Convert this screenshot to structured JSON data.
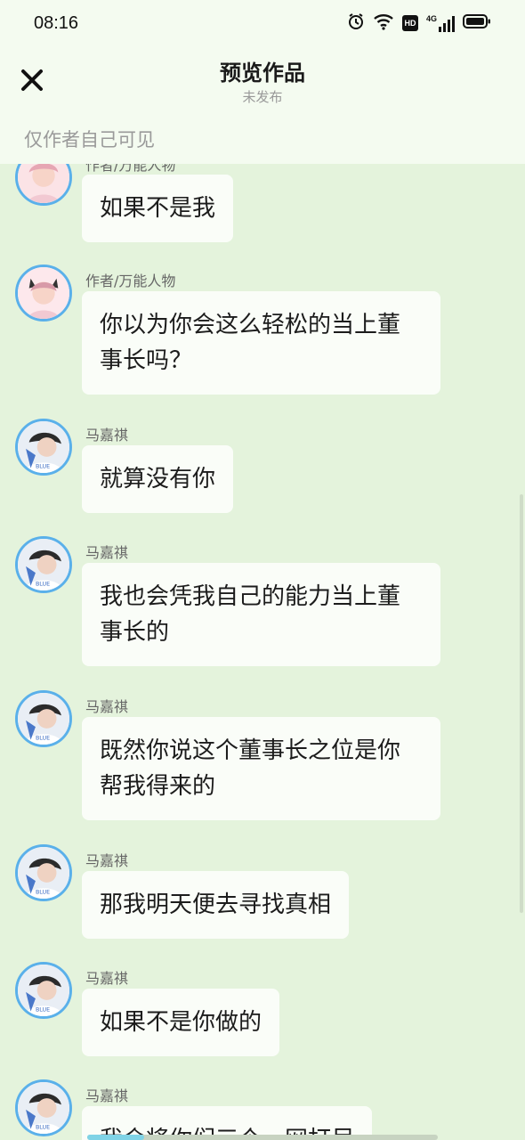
{
  "status_bar": {
    "time": "08:16",
    "icons": [
      "alarm-icon",
      "wifi-icon",
      "hd-icon",
      "signal-4g-icon",
      "battery-icon"
    ],
    "hd_label": "HD",
    "network_label": "4G"
  },
  "header": {
    "title": "预览作品",
    "subtitle": "未发布",
    "close_icon": "close-icon",
    "visibility_note": "仅作者自己可见"
  },
  "messages": [
    {
      "sender": "作者/万能人物",
      "text": "如果不是我"
    },
    {
      "sender": "作者/万能人物",
      "text": "你以为你会这么轻松的当上董事长吗？"
    },
    {
      "sender": "马嘉祺",
      "text": "就算没有你"
    },
    {
      "sender": "马嘉祺",
      "text": "我也会凭我自己的能力当上董事长的"
    },
    {
      "sender": "马嘉祺",
      "text": "既然你说这个董事长之位是你帮我得来的"
    },
    {
      "sender": "马嘉祺",
      "text": "那我明天便去寻找真相"
    },
    {
      "sender": "马嘉祺",
      "text": "如果不是你做的"
    },
    {
      "sender": "马嘉祺",
      "text": "我会将你们三个一网打尽"
    }
  ],
  "colors": {
    "background": "#e4f3dc",
    "header": "#f4fbf0",
    "bubble": "#fafdf8",
    "avatar_ring": "#5ab0ea"
  }
}
